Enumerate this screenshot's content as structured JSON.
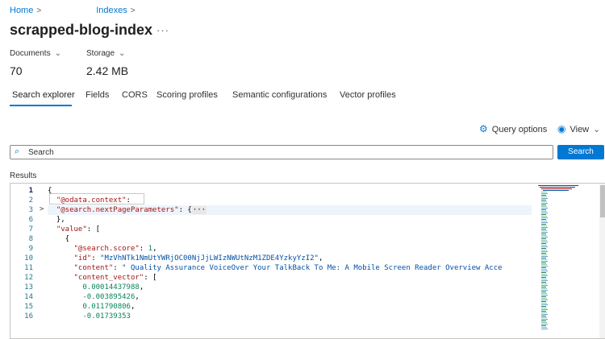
{
  "breadcrumb": {
    "home": "Home",
    "indexes": "Indexes"
  },
  "page": {
    "title": "scrapped-blog-index",
    "more": "···"
  },
  "stats": [
    {
      "label": "Documents",
      "value": "70"
    },
    {
      "label": "Storage",
      "value": "2.42 MB"
    }
  ],
  "tabs": [
    {
      "label": "Search explorer",
      "active": true
    },
    {
      "label": "Fields",
      "active": false
    },
    {
      "label": "CORS",
      "active": false
    },
    {
      "label": "Scoring profiles",
      "active": false
    },
    {
      "label": "Semantic configurations",
      "active": false
    },
    {
      "label": "Vector profiles",
      "active": false
    }
  ],
  "toolbar": {
    "query_options": "Query options",
    "view": "View"
  },
  "search": {
    "placeholder": "Search",
    "button": "Search"
  },
  "results": {
    "label": "Results"
  },
  "editor": {
    "line_numbers": [
      "1",
      "2",
      "3",
      "6",
      "7",
      "8",
      "9",
      "10",
      "11",
      "12",
      "13",
      "14",
      "15",
      "16"
    ],
    "lines": [
      [
        {
          "t": "{",
          "c": "p"
        }
      ],
      [
        {
          "t": "  ",
          "c": "p"
        },
        {
          "t": "\"@odata.context\"",
          "c": "k"
        },
        {
          "t": ":",
          "c": "p"
        }
      ],
      [
        {
          "t": "  ",
          "c": "p"
        },
        {
          "t": "\"@search.nextPageParameters\"",
          "c": "k"
        },
        {
          "t": ": {",
          "c": "p"
        },
        {
          "t": "···",
          "c": "folded"
        }
      ],
      [
        {
          "t": "  },",
          "c": "p"
        }
      ],
      [
        {
          "t": "  ",
          "c": "p"
        },
        {
          "t": "\"value\"",
          "c": "k"
        },
        {
          "t": ": [",
          "c": "p"
        }
      ],
      [
        {
          "t": "    {",
          "c": "p"
        }
      ],
      [
        {
          "t": "      ",
          "c": "p"
        },
        {
          "t": "\"@search.score\"",
          "c": "k"
        },
        {
          "t": ": ",
          "c": "p"
        },
        {
          "t": "1",
          "c": "n"
        },
        {
          "t": ",",
          "c": "p"
        }
      ],
      [
        {
          "t": "      ",
          "c": "p"
        },
        {
          "t": "\"id\"",
          "c": "k"
        },
        {
          "t": ": ",
          "c": "p"
        },
        {
          "t": "\"MzVhNTk1NmUtYWRjOC00NjJjLWIzNWUtNzM1ZDE4YzkyYzI2\"",
          "c": "v"
        },
        {
          "t": ",",
          "c": "p"
        }
      ],
      [
        {
          "t": "      ",
          "c": "p"
        },
        {
          "t": "\"content\"",
          "c": "k"
        },
        {
          "t": ": ",
          "c": "p"
        },
        {
          "t": "\" Quality Assurance VoiceOver Your TalkBack To Me: A Mobile Screen Reader Overview Acce",
          "c": "v"
        }
      ],
      [
        {
          "t": "      ",
          "c": "p"
        },
        {
          "t": "\"content_vector\"",
          "c": "k"
        },
        {
          "t": ": [",
          "c": "p"
        }
      ],
      [
        {
          "t": "        ",
          "c": "p"
        },
        {
          "t": "0.00014437988",
          "c": "n"
        },
        {
          "t": ",",
          "c": "p"
        }
      ],
      [
        {
          "t": "        ",
          "c": "p"
        },
        {
          "t": "-0.003895426",
          "c": "n"
        },
        {
          "t": ",",
          "c": "p"
        }
      ],
      [
        {
          "t": "        ",
          "c": "p"
        },
        {
          "t": "0.011790806",
          "c": "n"
        },
        {
          "t": ",",
          "c": "p"
        }
      ],
      [
        {
          "t": "        ",
          "c": "p"
        },
        {
          "t": "-0.01739353",
          "c": "n"
        }
      ]
    ]
  }
}
